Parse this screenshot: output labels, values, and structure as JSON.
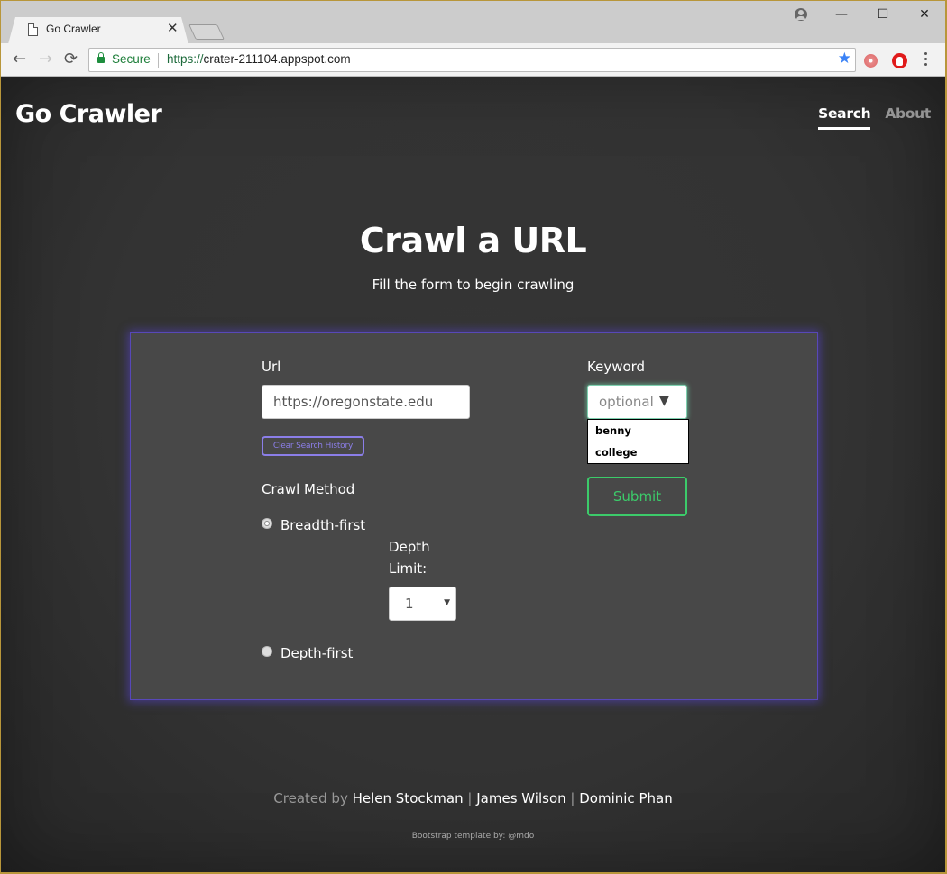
{
  "browser": {
    "tab_title": "Go Crawler",
    "tab_close": "✕",
    "security_label": "Secure",
    "url_scheme": "https://",
    "url_host": "crater-211104.appspot.com",
    "window_controls": {
      "minimize": "—",
      "maximize": "☐",
      "close": "✕"
    },
    "nav": {
      "back": "←",
      "forward": "→",
      "reload": "⟳"
    },
    "bookmark_icon": "★"
  },
  "header": {
    "brand": "Go Crawler",
    "nav_items": [
      {
        "label": "Search",
        "active": true
      },
      {
        "label": "About",
        "active": false
      }
    ]
  },
  "hero": {
    "title": "Crawl a URL",
    "subtitle": "Fill the form to begin crawling"
  },
  "form": {
    "url_label": "Url",
    "url_value": "https://oregonstate.edu",
    "clear_history_label": "Clear Search History",
    "crawl_method_label": "Crawl Method",
    "methods": [
      {
        "label": "Breadth-first",
        "checked": true
      },
      {
        "label": "Depth-first",
        "checked": false
      }
    ],
    "depth_limit_label_1": "Depth",
    "depth_limit_label_2": "Limit:",
    "depth_limit_value": "1",
    "depth_caret": "▼",
    "keyword_label": "Keyword",
    "keyword_placeholder": "optional",
    "keyword_caret": "▼",
    "keyword_suggestions": [
      "benny",
      "college"
    ],
    "submit_label": "Submit"
  },
  "footer": {
    "created_by": "Created by",
    "authors": [
      "Helen Stockman",
      "James Wilson",
      "Dominic Phan"
    ],
    "separator": "|",
    "template_credit": "Bootstrap template by: @mdo"
  }
}
